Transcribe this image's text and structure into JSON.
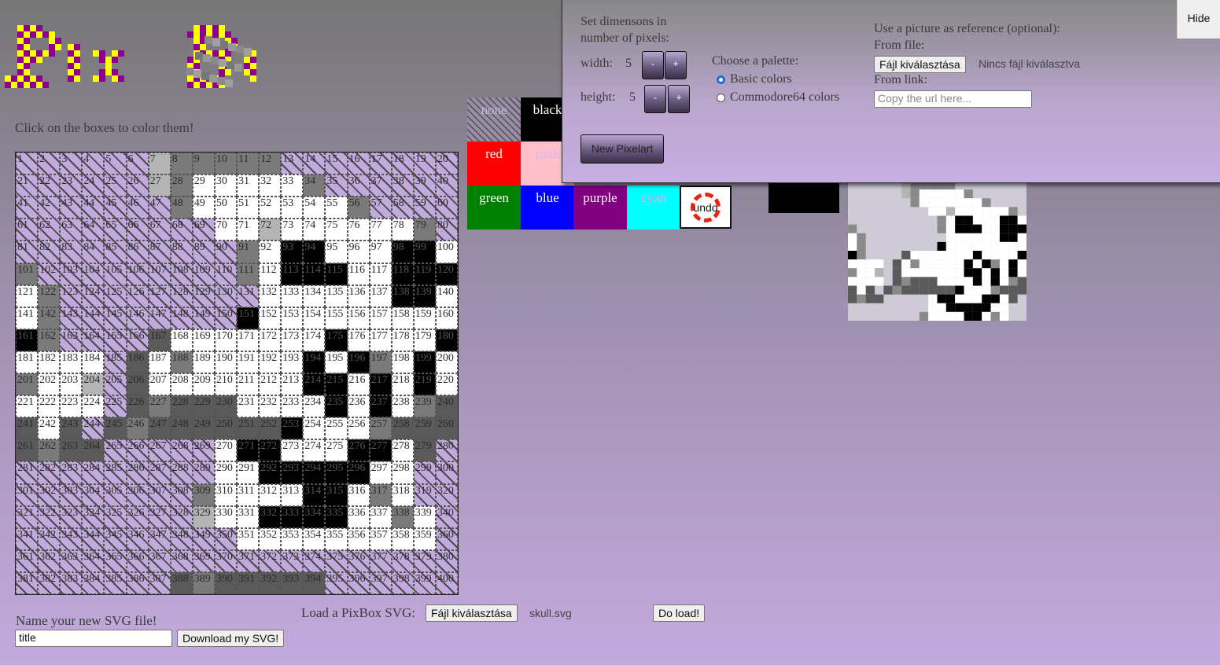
{
  "app": {
    "logo_text": "PixBox",
    "instruction": "Click on the boxes to color them!"
  },
  "grid": {
    "cols": 20,
    "rows": 20,
    "colors": "nnnnnnlgggggnnnnnnnnnnnnnnlgwwwwwgnnnnnnnnnnnnngwwwwwwwgnnnnnnnnnnnnnwwlwwwwwwgnnnnnnnnnnngwbbwwwbbwgnnnnnnnnngwbbbwwbbbwgnnnnnnnnnwwwwwwbbwwgnnnnnnnnbwwwwwwwwwbgnnnndwwwwwwwbwwwwbwwwwndwgwwwwwbwbgwbwgwwlndwwwwwwwbbwbwbwwwwwndgdddwwwwbwbwgddwdndgddddddbwwwgddddgddnnnnnwbbwwwbbwdnnnnnnnnnnwwbbbbbwwnnnnnnnnnngwwwwbbwgwnnnnnnnnnnlwwbbbbwwgwnnnnnnnnnnnwwwwwwwwwnnnnnnnnnnnnnnnnnnnnnnnnnnnndgdddddnnnnnnnnnnnnnnnn"
  },
  "palette": {
    "swatches": [
      {
        "id": "none",
        "label": "none",
        "color": "#5a5a5a"
      },
      {
        "id": "black",
        "label": "black",
        "color": "#000000"
      },
      {
        "id": "red",
        "label": "red",
        "color": "#ff0000"
      },
      {
        "id": "pink",
        "label": "pink",
        "color": "#ffc0cb"
      },
      {
        "id": "green",
        "label": "green",
        "color": "#008000"
      },
      {
        "id": "blue",
        "label": "blue",
        "color": "#0000ff"
      },
      {
        "id": "purple",
        "label": "purple",
        "color": "#800080"
      },
      {
        "id": "cyan",
        "label": "cyan",
        "color": "#00ffff"
      }
    ],
    "undo_label": "undo"
  },
  "current_color": "#000000",
  "panel": {
    "dimensions_label_line1": "Set dimensons in",
    "dimensions_label_line2": "number of pixels:",
    "width_label": "width:",
    "width_value": "5",
    "height_label": "height:",
    "height_value": "5",
    "minus": "-",
    "plus": "+",
    "palette_label": "Choose a palette:",
    "palette_basic": "Basic colors",
    "palette_c64": "Commodore64 colors",
    "new_pixelart": "New Pixelart",
    "reference_label": "Use a picture as reference (optional):",
    "from_file_label": "From file:",
    "file_button": "Fájl kiválasztása",
    "no_file": "Nincs fájl kiválasztva",
    "from_link_label": "From link:",
    "url_placeholder": "Copy the url here...",
    "hide_button": "Hide"
  },
  "save": {
    "name_label": "Name your new SVG file!",
    "name_value": "title",
    "download_button": "Download my SVG!"
  },
  "load": {
    "label": "Load a PixBox SVG:",
    "file_button": "Fájl kiválasztása",
    "file_name": "skull.svg",
    "do_load_button": "Do load!"
  }
}
